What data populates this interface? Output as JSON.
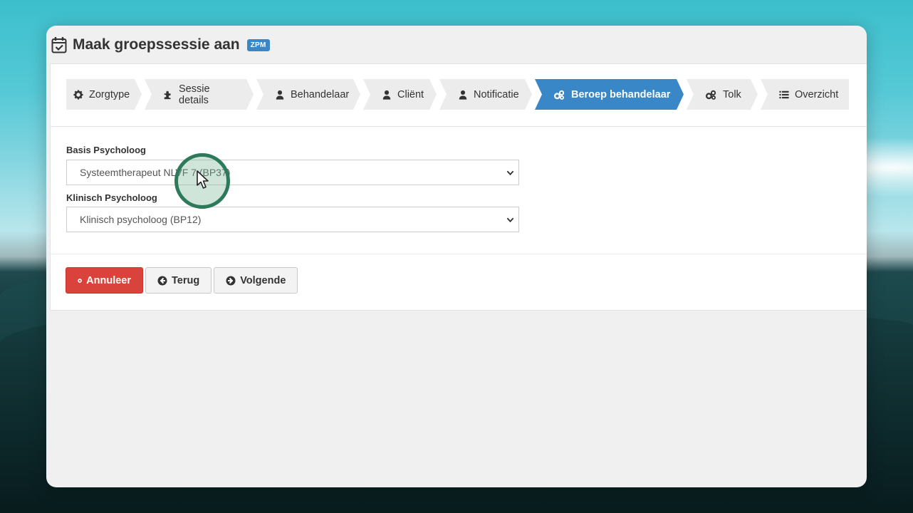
{
  "header": {
    "title": "Maak groepssessie aan",
    "badge": "ZPM"
  },
  "wizard": {
    "steps": [
      {
        "label": "Zorgtype",
        "icon": "gear-icon",
        "active": false
      },
      {
        "label": "Sessie details",
        "icon": "puzzle-icon",
        "active": false
      },
      {
        "label": "Behandelaar",
        "icon": "user-icon",
        "active": false
      },
      {
        "label": "Cliënt",
        "icon": "user-icon",
        "active": false
      },
      {
        "label": "Notificatie",
        "icon": "user-icon",
        "active": false
      },
      {
        "label": "Beroep behandelaar",
        "icon": "cogs-icon",
        "active": true
      },
      {
        "label": "Tolk",
        "icon": "cogs-icon",
        "active": false
      },
      {
        "label": "Overzicht",
        "icon": "list-icon",
        "active": false
      }
    ]
  },
  "form": {
    "field1": {
      "label": "Basis Psycholoog",
      "value": "Systeemtherapeut NLVF 7 (BP37)"
    },
    "field2": {
      "label": "Klinisch Psycholoog",
      "value": "Klinisch psycholoog (BP12)"
    }
  },
  "actions": {
    "cancel": "Annuleer",
    "back": "Terug",
    "next": "Volgende"
  },
  "colors": {
    "accent": "#3a87c8",
    "danger": "#d9433b",
    "cursor_ring": "#2d7a5b"
  }
}
